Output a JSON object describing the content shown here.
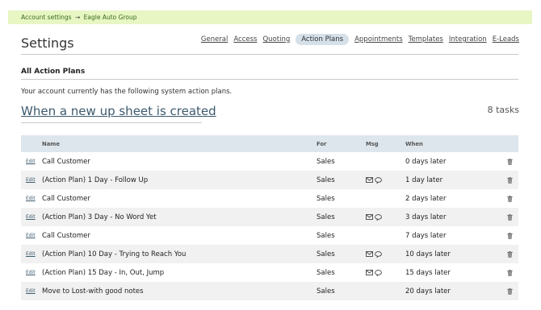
{
  "breadcrumb": {
    "parent": "Account settings",
    "separator": "→",
    "current": "Eagle Auto Group"
  },
  "page_title": "Settings",
  "nav": [
    {
      "label": "General",
      "active": false
    },
    {
      "label": "Access",
      "active": false
    },
    {
      "label": "Quoting",
      "active": false
    },
    {
      "label": "Action Plans",
      "active": true
    },
    {
      "label": "Appointments",
      "active": false
    },
    {
      "label": "Templates",
      "active": false
    },
    {
      "label": "Integration",
      "active": false
    },
    {
      "label": "E-Leads",
      "active": false
    }
  ],
  "section_title": "All Action Plans",
  "intro_text": "Your account currently has the following system action plans.",
  "plan": {
    "title": "When a new up sheet is created",
    "task_count": "8 tasks"
  },
  "table": {
    "headers": {
      "name": "Name",
      "for": "For",
      "msg": "Msg",
      "when": "When"
    },
    "edit_label": "Edit",
    "rows": [
      {
        "name": "Call Customer",
        "for": "Sales",
        "msg": false,
        "when": "0 days later"
      },
      {
        "name": "(Action Plan) 1 Day - Follow Up",
        "for": "Sales",
        "msg": true,
        "when": "1 day later"
      },
      {
        "name": "Call Customer",
        "for": "Sales",
        "msg": false,
        "when": "2 days later"
      },
      {
        "name": "(Action Plan) 3 Day - No Word Yet",
        "for": "Sales",
        "msg": true,
        "when": "3 days later"
      },
      {
        "name": "Call Customer",
        "for": "Sales",
        "msg": false,
        "when": "7 days later"
      },
      {
        "name": "(Action Plan) 10 Day - Trying to Reach You",
        "for": "Sales",
        "msg": true,
        "when": "10 days later"
      },
      {
        "name": "(Action Plan) 15 Day - In, Out, Jump",
        "for": "Sales",
        "msg": true,
        "when": "15 days later"
      },
      {
        "name": "Move to Lost-with good notes",
        "for": "Sales",
        "msg": false,
        "when": "20 days later"
      }
    ]
  },
  "icons": {
    "message": [
      "envelope-icon",
      "chat-bubble-icon"
    ],
    "delete": "trash-icon"
  },
  "colors": {
    "breadcrumb_bg": "#e7f6c2",
    "table_header_bg": "#dde6ec",
    "active_tab_bg": "#d5e0e8",
    "link": "#3d5a6e"
  }
}
